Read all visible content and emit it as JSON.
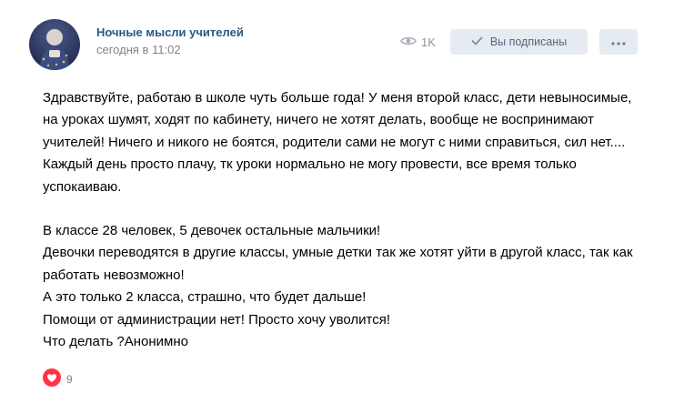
{
  "post": {
    "author": "Ночные мысли учителей",
    "time": "сегодня в 11:02",
    "views": "1K",
    "subscribe_label": "Вы подписаны",
    "text_paragraph_1": "Здравствуйте, работаю в школе чуть больше года! У меня второй класс, дети невыносимые, на уроках шумят, ходят по кабинету, ничего не хотят делать, вообще не воспринимают учителей! Ничего и никого не боятся, родители сами не могут с ними справиться, сил нет.... Каждый день просто плачу, тк уроки нормально не могу провести, все время только успокаиваю.",
    "lines": [
      "В классе 28 человек, 5 девочек остальные мальчики!",
      "Девочки переводятся в другие классы, умные детки так же хотят уйти в другой класс, так как работать невозможно!",
      "А это только 2 класса, страшно, что будет дальше!",
      "Помощи от администрации нет! Просто хочу уволится!",
      "Что делать ?Анонимно"
    ],
    "likes": "9"
  },
  "icons": {
    "views": "eye-icon",
    "subscribed": "checkmark-icon",
    "more": "more-dots-icon",
    "like": "heart-icon"
  },
  "colors": {
    "author": "#2a5885",
    "button_bg": "#e5ebf1",
    "button_text": "#55677d",
    "muted": "#828282",
    "like": "#ff3347"
  }
}
